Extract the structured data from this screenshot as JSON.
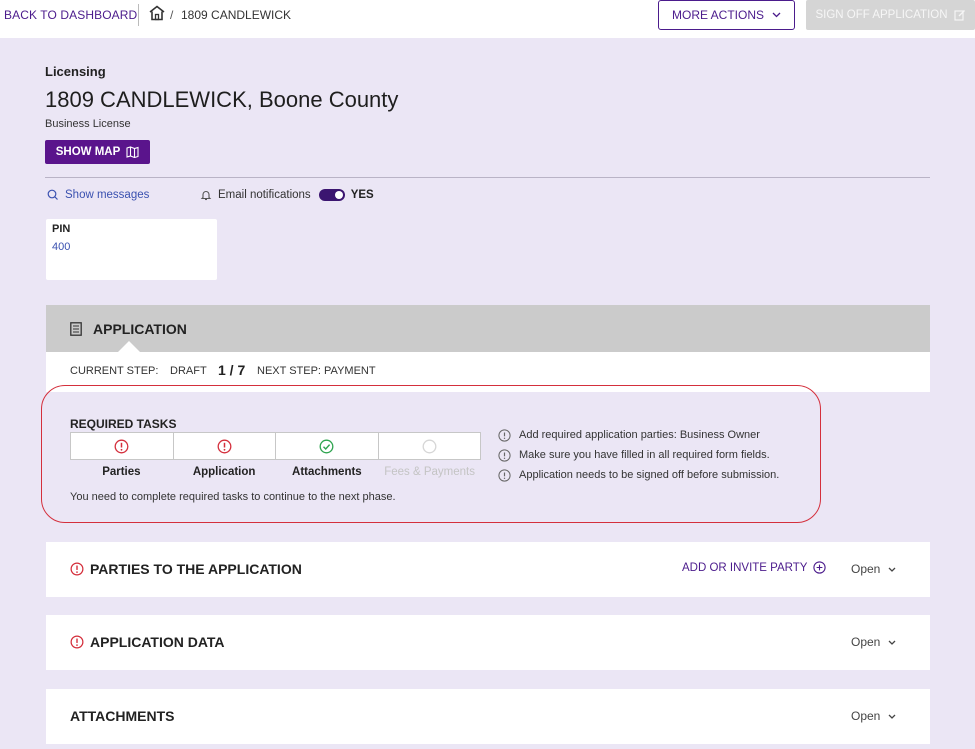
{
  "topbar": {
    "back_label": "BACK TO DASHBOARD",
    "breadcrumb_sep": "/",
    "breadcrumb_current": "1809 CANDLEWICK",
    "more_actions_label": "MORE ACTIONS",
    "sign_off_label": "SIGN OFF APPLICATION"
  },
  "header": {
    "section": "Licensing",
    "title": "1809 CANDLEWICK, Boone County",
    "subtitle": "Business License",
    "show_map_label": "SHOW MAP"
  },
  "meta": {
    "show_messages_label": "Show messages",
    "email_notifications_label": "Email notifications",
    "email_notifications_value": "YES"
  },
  "pin": {
    "label": "PIN",
    "value": "400"
  },
  "application": {
    "title": "APPLICATION",
    "current_step_label": "CURRENT STEP:",
    "current_step_value": "DRAFT",
    "step_count": "1 / 7",
    "next_step": "NEXT STEP: PAYMENT"
  },
  "required_tasks": {
    "title": "REQUIRED TASKS",
    "tasks": [
      {
        "label": "Parties",
        "status": "error"
      },
      {
        "label": "Application",
        "status": "error"
      },
      {
        "label": "Attachments",
        "status": "done"
      },
      {
        "label": "Fees & Payments",
        "status": "disabled"
      }
    ],
    "note": "You need to complete required tasks to continue to the next phase.",
    "messages": [
      "Add required application parties: Business Owner",
      "Make sure you have filled in all required form fields.",
      "Application needs to be signed off before submission."
    ]
  },
  "panels": {
    "parties": {
      "title": "PARTIES TO THE APPLICATION",
      "action": "ADD OR INVITE PARTY",
      "toggle": "Open"
    },
    "application_data": {
      "title": "APPLICATION DATA",
      "toggle": "Open"
    },
    "attachments": {
      "title": "ATTACHMENTS",
      "toggle": "Open"
    }
  },
  "colors": {
    "accent": "#5a148c",
    "error": "#d42f3c",
    "success": "#2ea44f",
    "page_bg": "#ebe6f5"
  }
}
